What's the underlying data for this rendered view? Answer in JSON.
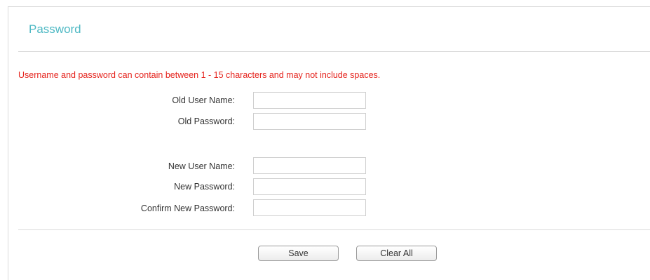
{
  "section": {
    "title": "Password"
  },
  "notice": "Username and password can contain between 1 - 15 characters and may not include spaces.",
  "form": {
    "old_user_name": {
      "label": "Old User Name:",
      "value": ""
    },
    "old_password": {
      "label": "Old Password:",
      "value": ""
    },
    "new_user_name": {
      "label": "New User Name:",
      "value": ""
    },
    "new_password": {
      "label": "New Password:",
      "value": ""
    },
    "confirm_new_password": {
      "label": "Confirm New Password:",
      "value": ""
    }
  },
  "buttons": {
    "save": "Save",
    "clear_all": "Clear All"
  },
  "colors": {
    "title": "#4fb9c4",
    "notice": "#e5231d"
  }
}
